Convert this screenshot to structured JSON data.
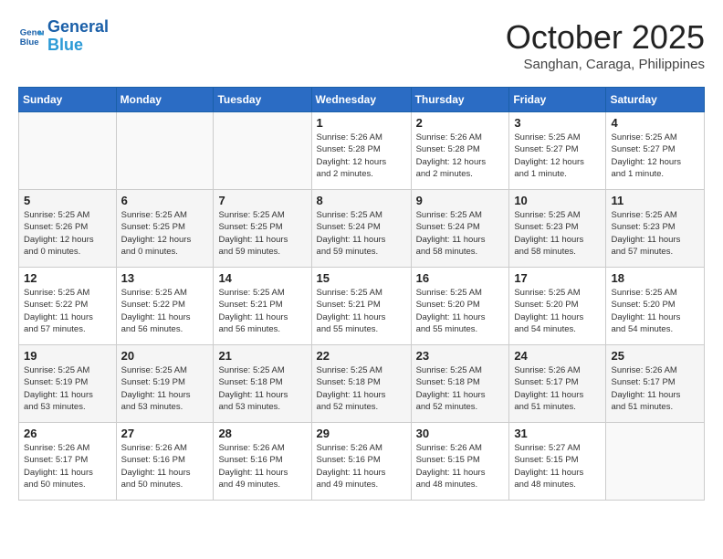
{
  "header": {
    "logo_general": "General",
    "logo_blue": "Blue",
    "month": "October 2025",
    "location": "Sanghan, Caraga, Philippines"
  },
  "calendar": {
    "days_of_week": [
      "Sunday",
      "Monday",
      "Tuesday",
      "Wednesday",
      "Thursday",
      "Friday",
      "Saturday"
    ],
    "weeks": [
      [
        {
          "day": "",
          "info": ""
        },
        {
          "day": "",
          "info": ""
        },
        {
          "day": "",
          "info": ""
        },
        {
          "day": "1",
          "info": "Sunrise: 5:26 AM\nSunset: 5:28 PM\nDaylight: 12 hours\nand 2 minutes."
        },
        {
          "day": "2",
          "info": "Sunrise: 5:26 AM\nSunset: 5:28 PM\nDaylight: 12 hours\nand 2 minutes."
        },
        {
          "day": "3",
          "info": "Sunrise: 5:25 AM\nSunset: 5:27 PM\nDaylight: 12 hours\nand 1 minute."
        },
        {
          "day": "4",
          "info": "Sunrise: 5:25 AM\nSunset: 5:27 PM\nDaylight: 12 hours\nand 1 minute."
        }
      ],
      [
        {
          "day": "5",
          "info": "Sunrise: 5:25 AM\nSunset: 5:26 PM\nDaylight: 12 hours\nand 0 minutes."
        },
        {
          "day": "6",
          "info": "Sunrise: 5:25 AM\nSunset: 5:25 PM\nDaylight: 12 hours\nand 0 minutes."
        },
        {
          "day": "7",
          "info": "Sunrise: 5:25 AM\nSunset: 5:25 PM\nDaylight: 11 hours\nand 59 minutes."
        },
        {
          "day": "8",
          "info": "Sunrise: 5:25 AM\nSunset: 5:24 PM\nDaylight: 11 hours\nand 59 minutes."
        },
        {
          "day": "9",
          "info": "Sunrise: 5:25 AM\nSunset: 5:24 PM\nDaylight: 11 hours\nand 58 minutes."
        },
        {
          "day": "10",
          "info": "Sunrise: 5:25 AM\nSunset: 5:23 PM\nDaylight: 11 hours\nand 58 minutes."
        },
        {
          "day": "11",
          "info": "Sunrise: 5:25 AM\nSunset: 5:23 PM\nDaylight: 11 hours\nand 57 minutes."
        }
      ],
      [
        {
          "day": "12",
          "info": "Sunrise: 5:25 AM\nSunset: 5:22 PM\nDaylight: 11 hours\nand 57 minutes."
        },
        {
          "day": "13",
          "info": "Sunrise: 5:25 AM\nSunset: 5:22 PM\nDaylight: 11 hours\nand 56 minutes."
        },
        {
          "day": "14",
          "info": "Sunrise: 5:25 AM\nSunset: 5:21 PM\nDaylight: 11 hours\nand 56 minutes."
        },
        {
          "day": "15",
          "info": "Sunrise: 5:25 AM\nSunset: 5:21 PM\nDaylight: 11 hours\nand 55 minutes."
        },
        {
          "day": "16",
          "info": "Sunrise: 5:25 AM\nSunset: 5:20 PM\nDaylight: 11 hours\nand 55 minutes."
        },
        {
          "day": "17",
          "info": "Sunrise: 5:25 AM\nSunset: 5:20 PM\nDaylight: 11 hours\nand 54 minutes."
        },
        {
          "day": "18",
          "info": "Sunrise: 5:25 AM\nSunset: 5:20 PM\nDaylight: 11 hours\nand 54 minutes."
        }
      ],
      [
        {
          "day": "19",
          "info": "Sunrise: 5:25 AM\nSunset: 5:19 PM\nDaylight: 11 hours\nand 53 minutes."
        },
        {
          "day": "20",
          "info": "Sunrise: 5:25 AM\nSunset: 5:19 PM\nDaylight: 11 hours\nand 53 minutes."
        },
        {
          "day": "21",
          "info": "Sunrise: 5:25 AM\nSunset: 5:18 PM\nDaylight: 11 hours\nand 53 minutes."
        },
        {
          "day": "22",
          "info": "Sunrise: 5:25 AM\nSunset: 5:18 PM\nDaylight: 11 hours\nand 52 minutes."
        },
        {
          "day": "23",
          "info": "Sunrise: 5:25 AM\nSunset: 5:18 PM\nDaylight: 11 hours\nand 52 minutes."
        },
        {
          "day": "24",
          "info": "Sunrise: 5:26 AM\nSunset: 5:17 PM\nDaylight: 11 hours\nand 51 minutes."
        },
        {
          "day": "25",
          "info": "Sunrise: 5:26 AM\nSunset: 5:17 PM\nDaylight: 11 hours\nand 51 minutes."
        }
      ],
      [
        {
          "day": "26",
          "info": "Sunrise: 5:26 AM\nSunset: 5:17 PM\nDaylight: 11 hours\nand 50 minutes."
        },
        {
          "day": "27",
          "info": "Sunrise: 5:26 AM\nSunset: 5:16 PM\nDaylight: 11 hours\nand 50 minutes."
        },
        {
          "day": "28",
          "info": "Sunrise: 5:26 AM\nSunset: 5:16 PM\nDaylight: 11 hours\nand 49 minutes."
        },
        {
          "day": "29",
          "info": "Sunrise: 5:26 AM\nSunset: 5:16 PM\nDaylight: 11 hours\nand 49 minutes."
        },
        {
          "day": "30",
          "info": "Sunrise: 5:26 AM\nSunset: 5:15 PM\nDaylight: 11 hours\nand 48 minutes."
        },
        {
          "day": "31",
          "info": "Sunrise: 5:27 AM\nSunset: 5:15 PM\nDaylight: 11 hours\nand 48 minutes."
        },
        {
          "day": "",
          "info": ""
        }
      ]
    ]
  }
}
